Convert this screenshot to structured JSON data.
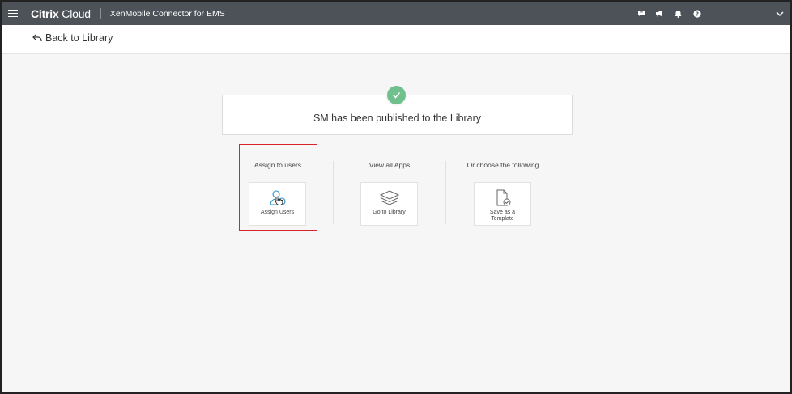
{
  "header": {
    "brand_bold": "Citrix",
    "brand_light": "Cloud",
    "product": "XenMobile Connector for EMS",
    "icons": [
      "chat-icon",
      "megaphone-icon",
      "bell-icon",
      "help-icon"
    ]
  },
  "nav": {
    "back_label": "Back to Library"
  },
  "banner": {
    "message": "SM has been published to the Library",
    "status_color": "#6fc08d"
  },
  "options": [
    {
      "title": "Assign to users",
      "tile_label": "Assign Users",
      "icon": "assign-users-icon"
    },
    {
      "title": "View all Apps",
      "tile_label": "Go to Library",
      "icon": "library-stack-icon"
    },
    {
      "title": "Or choose the following",
      "tile_label": "Save as a Template",
      "icon": "template-document-icon"
    }
  ],
  "colors": {
    "topbar": "#4d5259",
    "highlight": "#d9232a",
    "accent_icon": "#2a8fc0"
  }
}
